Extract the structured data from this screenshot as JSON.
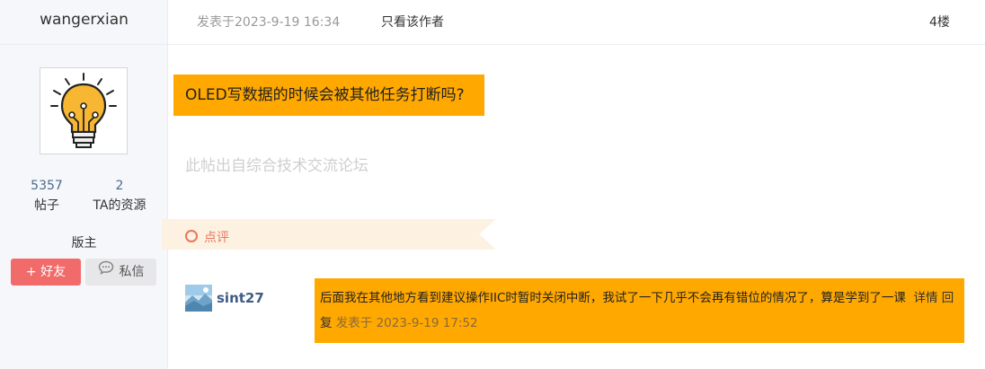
{
  "author": {
    "name": "wangerxian",
    "stats": {
      "posts_value": "5357",
      "posts_label": "帖子",
      "resources_value": "2",
      "resources_label": "TA的资源"
    },
    "role": "版主",
    "add_friend_label": "+ 好友",
    "message_label": "私信"
  },
  "post_header": {
    "posted_at": "发表于2023-9-19 16:34",
    "only_author_label": "只看该作者",
    "floor": "4楼"
  },
  "post": {
    "title": "OLED写数据的时候会被其他任务打断吗?",
    "source_note": "此帖出自综合技术交流论坛"
  },
  "comment_section": {
    "label": "点评"
  },
  "comment": {
    "user": "sint27",
    "text": "后面我在其他地方看到建议操作IIC时暂时关闭中断，我试了一下几乎不会再有错位的情况了，算是学到了一课",
    "detail_label": "详情",
    "reply_label": "回复",
    "meta": "发表于 2023-9-19 17:52"
  },
  "colors": {
    "highlight": "#ffa800",
    "friend_button": "#f26b6b",
    "comment_accent": "#e8765d",
    "link_blue": "#3e5d84"
  }
}
